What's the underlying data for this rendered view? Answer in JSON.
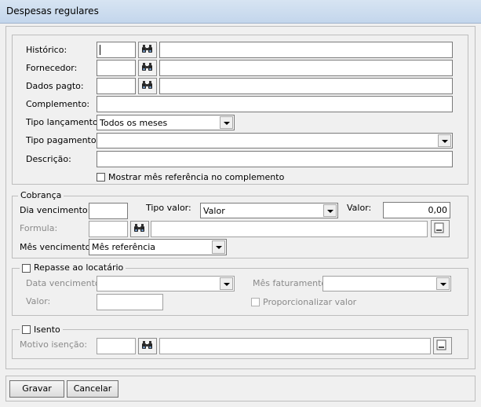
{
  "window": {
    "title": "Despesas regulares"
  },
  "main": {
    "historico_label": "Histórico:",
    "fornecedor_label": "Fornecedor:",
    "dados_pagto_label": "Dados pagto:",
    "complemento_label": "Complemento:",
    "tipo_lancamento_label": "Tipo lançamento:",
    "tipo_lancamento_value": "Todos os meses",
    "tipo_pagamento_label": "Tipo pagamento:",
    "tipo_pagamento_value": "",
    "descricao_label": "Descrição:",
    "mostrar_mes_label": "Mostrar mês referência no complemento"
  },
  "cobranca": {
    "legend": "Cobrança",
    "dia_vencimento_label": "Dia vencimento:",
    "tipo_valor_label": "Tipo valor:",
    "tipo_valor_value": "Valor",
    "valor_label": "Valor:",
    "valor_value": "0,00",
    "formula_label": "Formula:",
    "mes_vencimento_label": "Mês vencimento:",
    "mes_vencimento_value": "Mês referência"
  },
  "repasse": {
    "legend": "Repasse ao locatário",
    "data_vencimento_label": "Data vencimento:",
    "mes_faturamento_label": "Mês faturamento:",
    "valor_label": "Valor:",
    "proporcionalizar_label": "Proporcionalizar valor"
  },
  "isento": {
    "legend": "Isento",
    "motivo_label": "Motivo isenção:"
  },
  "footer": {
    "gravar_label": "Gravar",
    "cancelar_label": "Cancelar"
  }
}
